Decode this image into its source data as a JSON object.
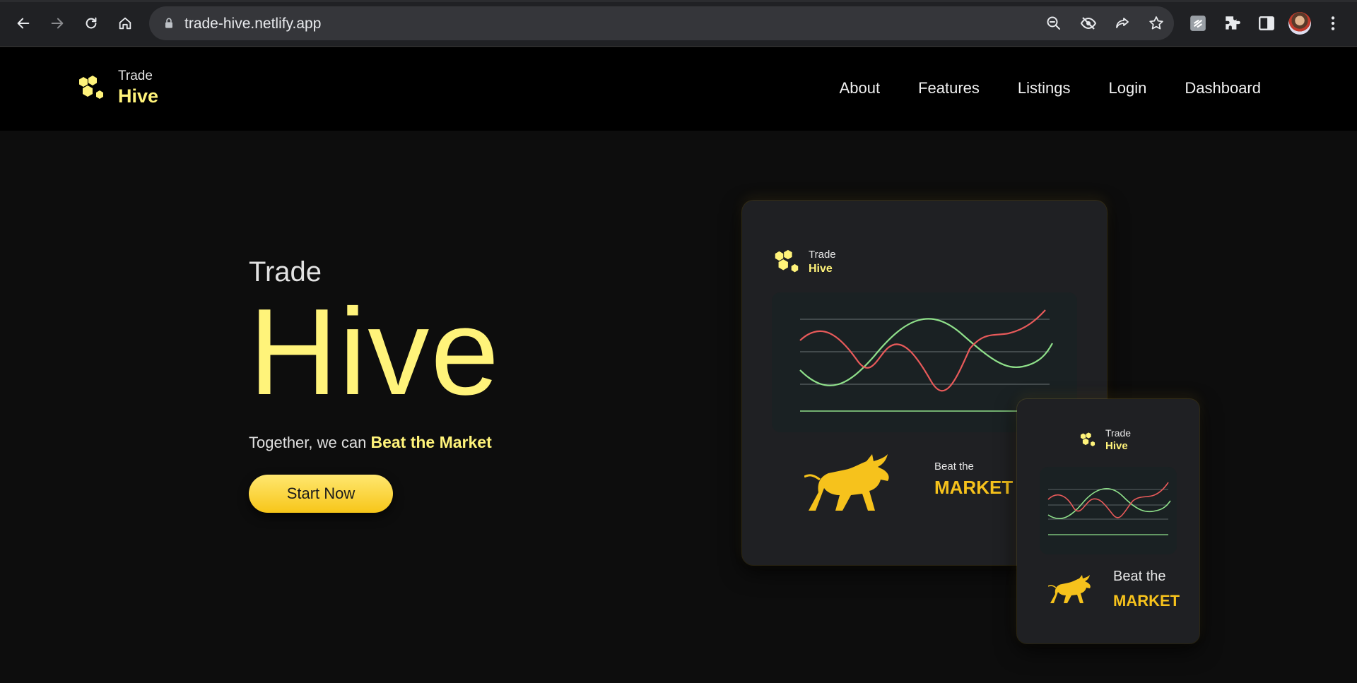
{
  "browser": {
    "url": "trade-hive.netlify.app"
  },
  "header": {
    "brand_small": "Trade",
    "brand_big": "Hive",
    "nav": [
      "About",
      "Features",
      "Listings",
      "Login",
      "Dashboard"
    ]
  },
  "hero": {
    "trade": "Trade",
    "hive": "Hive",
    "tagline_prefix": "Together, we can ",
    "tagline_highlight": "Beat the Market",
    "cta": "Start Now"
  },
  "mockup": {
    "brand_small": "Trade",
    "brand_big": "Hive",
    "beat_small": "Beat the",
    "beat_big": "MARKET"
  },
  "colors": {
    "accent_yellow": "#fff37a",
    "gold": "#f6c21c",
    "line_red": "#e85a5a",
    "line_green": "#8fe08a",
    "background": "#0d0d0d"
  }
}
